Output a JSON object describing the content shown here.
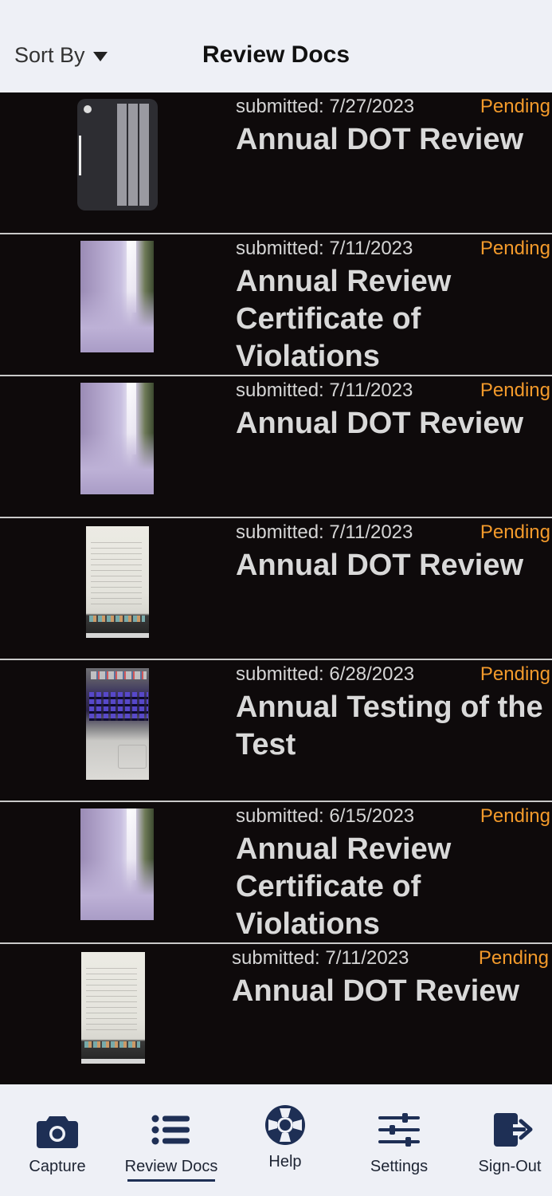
{
  "header": {
    "sort_label": "Sort By",
    "title": "Review Docs"
  },
  "documents": [
    {
      "submitted": "submitted: 7/27/2023",
      "status": "Pending",
      "title": "Annual DOT Review",
      "thumbnail": "keyboard-photo"
    },
    {
      "submitted": "submitted: 7/11/2023",
      "status": "Pending",
      "title": "Annual Review Certificate of Violations",
      "thumbnail": "waterfall-photo"
    },
    {
      "submitted": "submitted: 7/11/2023",
      "status": "Pending",
      "title": "Annual DOT Review",
      "thumbnail": "waterfall-photo"
    },
    {
      "submitted": "submitted: 7/11/2023",
      "status": "Pending",
      "title": "Annual DOT Review",
      "thumbnail": "screen-photo"
    },
    {
      "submitted": "submitted: 6/28/2023",
      "status": "Pending",
      "title": "Annual Testing of the Test",
      "thumbnail": "laptop-photo"
    },
    {
      "submitted": "submitted: 6/15/2023",
      "status": "Pending",
      "title": "Annual Review Certificate of Violations",
      "thumbnail": "waterfall-photo"
    },
    {
      "submitted": "submitted: 7/11/2023",
      "status": "Pending",
      "title": "Annual DOT Review",
      "thumbnail": "screen-photo"
    }
  ],
  "nav": {
    "items": [
      {
        "label": "Capture",
        "icon": "camera-icon"
      },
      {
        "label": "Review Docs",
        "icon": "list-icon",
        "active": true
      },
      {
        "label": "Help",
        "icon": "lifebuoy-icon"
      },
      {
        "label": "Settings",
        "icon": "sliders-icon"
      },
      {
        "label": "Sign-Out",
        "icon": "sign-out-icon"
      }
    ]
  },
  "colors": {
    "header_bg": "#eef0f6",
    "list_bg": "#0e0a0b",
    "status_pending": "#f39a2b",
    "nav_icon": "#1e2f55"
  }
}
